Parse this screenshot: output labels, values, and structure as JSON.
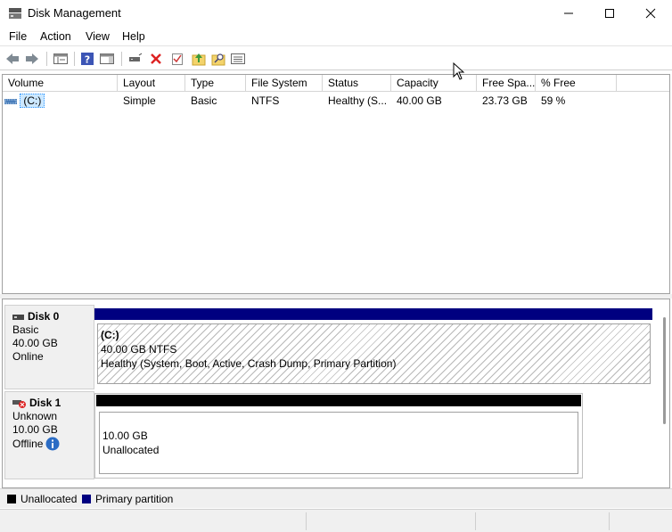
{
  "window": {
    "title": "Disk Management",
    "minimize_icon": "minimize-icon",
    "maximize_icon": "maximize-icon",
    "close_icon": "close-icon"
  },
  "menu": [
    "File",
    "Action",
    "View",
    "Help"
  ],
  "toolbar": {
    "icons": [
      "back-icon",
      "forward-icon",
      "console-tree-icon",
      "help-icon",
      "show-hide-action-pane-icon",
      "connect-virtual-disk-icon",
      "delete-icon",
      "properties-icon",
      "export-icon",
      "find-icon",
      "list-view-icon"
    ]
  },
  "volumes": {
    "columns": [
      "Volume",
      "Layout",
      "Type",
      "File System",
      "Status",
      "Capacity",
      "Free Spa...",
      "% Free"
    ],
    "rows": [
      {
        "volume": "(C:)",
        "layout": "Simple",
        "type": "Basic",
        "filesystem": "NTFS",
        "status": "Healthy (S...",
        "capacity": "40.00 GB",
        "free": "23.73 GB",
        "pct_free": "59 %"
      }
    ]
  },
  "disks": [
    {
      "name": "Disk 0",
      "type": "Basic",
      "size": "40.00 GB",
      "state": "Online",
      "partition": {
        "label": "(C:)",
        "size_fs": "40.00 GB NTFS",
        "status": "Healthy (System, Boot, Active, Crash Dump, Primary Partition)",
        "bar_color": "#000080"
      }
    },
    {
      "name": "Disk 1",
      "type": "Unknown",
      "size": "10.00 GB",
      "state": "Offline",
      "state_icon": "info-icon",
      "partition": {
        "size": "10.00 GB",
        "status": "Unallocated",
        "bar_color": "#000000"
      }
    }
  ],
  "legend": [
    {
      "label": "Unallocated",
      "color": "#000000"
    },
    {
      "label": "Primary partition",
      "color": "#000080"
    }
  ]
}
